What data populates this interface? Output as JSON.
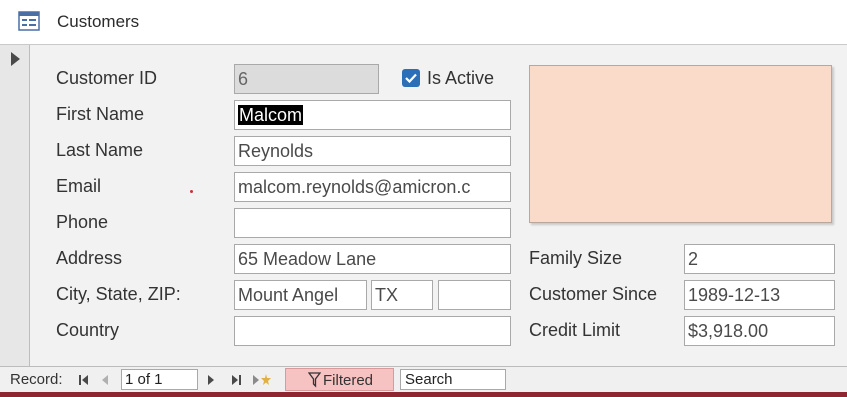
{
  "window": {
    "title": "Customers",
    "icon": "form-view-icon"
  },
  "form": {
    "customer_id": {
      "label": "Customer ID",
      "value": "6"
    },
    "is_active": {
      "label": "Is Active",
      "checked": true
    },
    "first_name": {
      "label": "First Name",
      "value": "Malcom"
    },
    "last_name": {
      "label": "Last Name",
      "value": "Reynolds"
    },
    "email": {
      "label": "Email",
      "value": "malcom.reynolds@amicron.c"
    },
    "phone": {
      "label": "Phone",
      "value": ""
    },
    "address": {
      "label": "Address",
      "value": "65 Meadow Lane"
    },
    "city_state_zip": {
      "label": "City, State, ZIP:",
      "city": "Mount Angel",
      "state": "TX",
      "zip": ""
    },
    "country": {
      "label": "Country",
      "value": ""
    },
    "family_size": {
      "label": "Family Size",
      "value": "2"
    },
    "customer_since": {
      "label": "Customer Since",
      "value": "1989-12-13"
    },
    "credit_limit": {
      "label": "Credit Limit",
      "value": "$3,918.00"
    }
  },
  "navigation": {
    "record_label": "Record:",
    "position": "1 of 1",
    "filter_label": "Filtered",
    "search_label": "Search"
  },
  "colors": {
    "photo_bg": "#fadbca",
    "filter_bg": "#f6c2c2",
    "checkbox": "#2a6fb8",
    "bottom_edge": "#8d2630"
  }
}
